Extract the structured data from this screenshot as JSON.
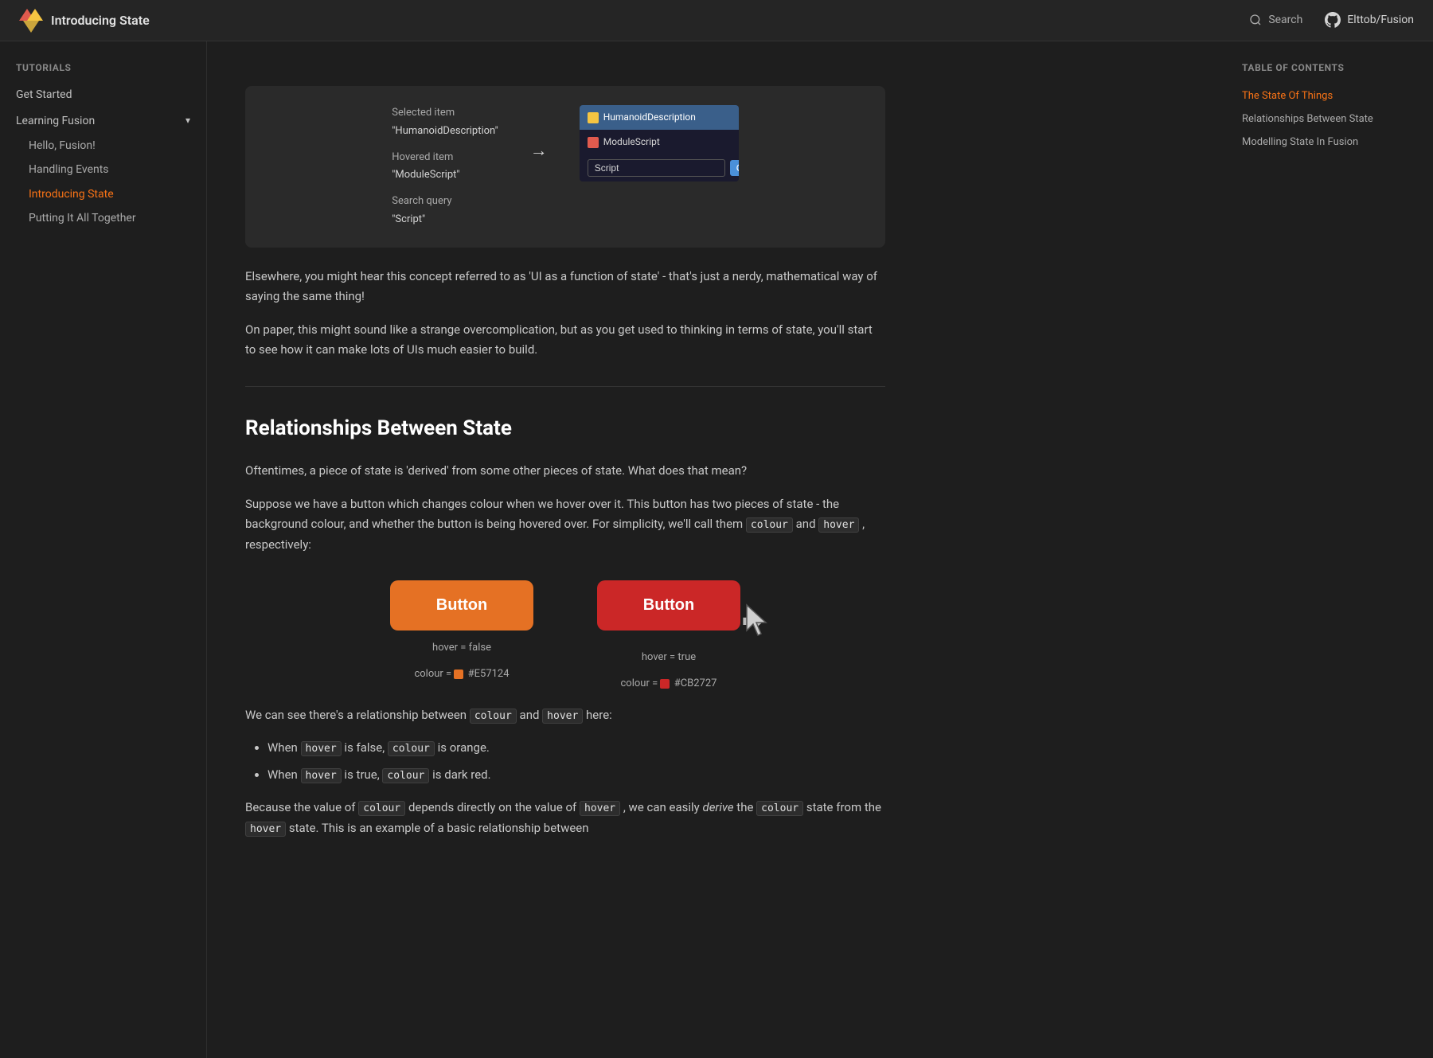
{
  "header": {
    "title": "Introducing State",
    "search_placeholder": "Search",
    "github_label": "Elttob/Fusion"
  },
  "sidebar": {
    "tutorials_label": "Tutorials",
    "get_started_label": "Get Started",
    "learning_fusion_label": "Learning Fusion",
    "sub_items": [
      {
        "label": "Hello, Fusion!",
        "active": false
      },
      {
        "label": "Handling Events",
        "active": false
      },
      {
        "label": "Introducing State",
        "active": true
      },
      {
        "label": "Putting It All Together",
        "active": false
      }
    ]
  },
  "toc": {
    "title": "Table of contents",
    "items": [
      {
        "label": "The State Of Things",
        "active": true
      },
      {
        "label": "Relationships Between State",
        "active": false
      },
      {
        "label": "Modelling State In Fusion",
        "active": false
      }
    ]
  },
  "demo_search": {
    "selected_item_label": "Selected item",
    "selected_item_value": "\"HumanoidDescription\"",
    "hovered_item_label": "Hovered item",
    "hovered_item_value": "\"ModuleScript\"",
    "search_query_label": "Search query",
    "search_query_value": "\"Script\"",
    "right_item1": "HumanoidDescription",
    "right_item2": "ModuleScript",
    "input_value": "Script",
    "convert_label": "Convert"
  },
  "content": {
    "paragraph1": "Elsewhere, you might hear this concept referred to as 'UI as a function of state' - that's just a nerdy, mathematical way of saying the same thing!",
    "paragraph2": "On paper, this might sound like a strange overcomplication, but as you get used to thinking in terms of state, you'll start to see how it can make lots of UIs much easier to build.",
    "section_title": "Relationships Between State",
    "para3": "Oftentimes, a piece of state is 'derived' from some other pieces of state. What does that mean?",
    "para4_before": "Suppose we have a button which changes colour when we hover over it. This button has two pieces of state - the background colour, and whether the button is being hovered over. For simplicity, we'll call them",
    "para4_code1": "colour",
    "para4_mid": "and",
    "para4_code2": "hover",
    "para4_after": ", respectively:",
    "button_label": "Button",
    "btn1_state1": "hover = false",
    "btn1_state2_prefix": "colour = ",
    "btn1_color": "#E57124",
    "btn1_color_hex": "#E57124",
    "btn2_state1": "hover = true",
    "btn2_state2_prefix": "colour = ",
    "btn2_color": "#CB2727",
    "btn2_color_hex": "#CB2727",
    "para5_before": "We can see there's a relationship between",
    "para5_code1": "colour",
    "para5_mid": "and",
    "para5_code2": "hover",
    "para5_after": "here:",
    "bullet1_before": "When",
    "bullet1_code": "hover",
    "bullet1_mid": "is false,",
    "bullet1_code2": "colour",
    "bullet1_after": "is orange.",
    "bullet2_before": "When",
    "bullet2_code": "hover",
    "bullet2_mid": "is true,",
    "bullet2_code2": "colour",
    "bullet2_after": "is dark red.",
    "para6_before": "Because the value of",
    "para6_code1": "colour",
    "para6_mid": "depends directly on the value of",
    "para6_code2": "hover",
    "para6_after": ", we can easily",
    "para6_em": "derive",
    "para6_end": "the",
    "para6_code3": "colour",
    "para6_last": "state from the",
    "para6_code4": "hover",
    "para6_final": "state. This is an example of a basic relationship between"
  }
}
